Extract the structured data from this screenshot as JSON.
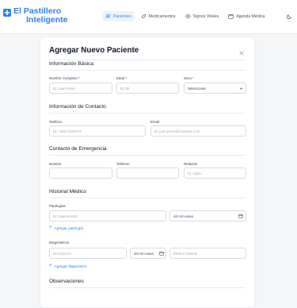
{
  "brand": {
    "line1": "El Pastillero",
    "line2": "Inteligente"
  },
  "nav": [
    {
      "label": "Pacientes",
      "icon": "users-icon",
      "active": true
    },
    {
      "label": "Medicamentos",
      "icon": "pill-icon",
      "active": false
    },
    {
      "label": "Signos Vitales",
      "icon": "eye-icon",
      "active": false
    },
    {
      "label": "Agenda Médica",
      "icon": "calendar-icon",
      "active": false
    }
  ],
  "form": {
    "title": "Agregar Nuevo Paciente",
    "basic": {
      "heading": "Información Básica",
      "name_label": "Nombre Completo *",
      "name_placeholder": "Ej: Juan Pérez",
      "age_label": "Edad *",
      "age_placeholder": "Ej: 65",
      "sex_label": "Sexo *",
      "sex_value": "Seleccionar"
    },
    "contact": {
      "heading": "Información de Contacto",
      "phone_label": "Teléfono",
      "phone_placeholder": "Ej: +56912345678",
      "email_label": "Email",
      "email_placeholder": "Ej: juan.perez@example.com"
    },
    "emergency": {
      "heading": "Contacto de Emergencia",
      "name_label": "Nombre",
      "phone_label": "Teléfono",
      "relation_label": "Relación",
      "relation_placeholder": "Ej: Hija/o"
    },
    "history": {
      "heading": "Historial Médico",
      "pathologies_label": "Patologías",
      "pathology_placeholder": "Ej: Hipertensión",
      "date_placeholder": "dd-mm-aaaa",
      "add_pathology": "Agregar patología",
      "diagnoses_label": "Diagnósticos",
      "description_placeholder": "Descripción",
      "doctor_placeholder": "Médico tratante",
      "add_diagnosis": "Agregar diagnóstico"
    },
    "observations": {
      "heading": "Observaciones"
    }
  },
  "colors": {
    "accent": "#2f80ed",
    "text": "#111827",
    "border": "#d6dbe2"
  }
}
